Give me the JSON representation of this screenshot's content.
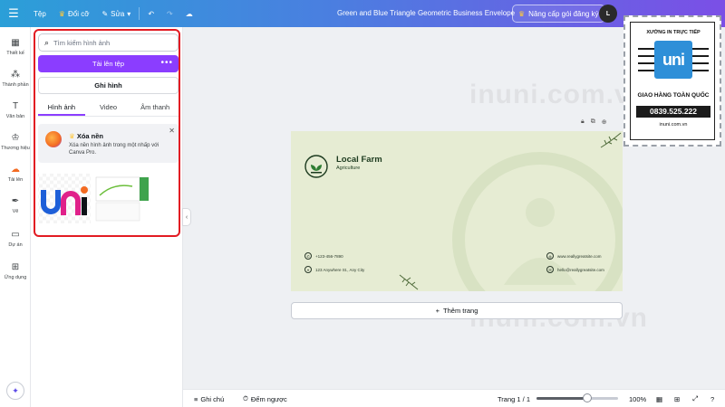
{
  "topbar": {
    "file": "Tệp",
    "resize": "Đổi cỡ",
    "edit": "Sửa",
    "title": "Green and Blue Triangle Geometric Business Envelope",
    "upgrade": "Nâng cấp gói đăng ký",
    "avatar": "L"
  },
  "rail": {
    "items": [
      {
        "label": "Thiết kế",
        "icon": "layout-icon"
      },
      {
        "label": "Thành phần",
        "icon": "elements-icon"
      },
      {
        "label": "Văn bản",
        "icon": "text-icon"
      },
      {
        "label": "Thương hiệu",
        "icon": "brand-icon"
      },
      {
        "label": "Tải lên",
        "icon": "upload-cloud-icon"
      },
      {
        "label": "Vẽ",
        "icon": "pen-icon"
      },
      {
        "label": "Dự án",
        "icon": "folder-icon"
      },
      {
        "label": "Ứng dụng",
        "icon": "apps-icon"
      }
    ]
  },
  "panel": {
    "search_placeholder": "Tìm kiếm hình ảnh",
    "upload_label": "Tải lên tệp",
    "more": "•••",
    "record_label": "Ghi hình",
    "tabs": [
      "Hình ảnh",
      "Video",
      "Âm thanh"
    ],
    "promo": {
      "title": "Xóa nền",
      "desc": "Xóa nền hình ảnh trong một nhấp với Canva Pro."
    }
  },
  "watermarks": [
    "inuni.com.vn",
    "inuni.com.vn"
  ],
  "envelope": {
    "title": "Local Farm",
    "subtitle": "Agriculture",
    "phone": "+123-456-7890",
    "address": "123 Anywhere St., Any City",
    "website": "www.reallygreatsite.com",
    "email": "hello@reallygreatsite.com"
  },
  "add_page": "Thêm trang",
  "bottombar": {
    "notes": "Ghi chú",
    "timer": "Đếm ngược",
    "page": "Trang 1 / 1",
    "zoom": "100%",
    "zoom_level": 0.62
  },
  "stamp": {
    "top": "XƯỞNG IN TRỰC TIẾP",
    "logo": "uni",
    "middle": "GIAO HÀNG TOÀN QUỐC",
    "phone": "0839.525.222",
    "web": "inuni.com.vn"
  },
  "colors": {
    "accent": "#8b3dff",
    "highlight": "#e21b23",
    "envelope_bg": "#e6ecd3",
    "logo_green": "#2e7d32"
  }
}
